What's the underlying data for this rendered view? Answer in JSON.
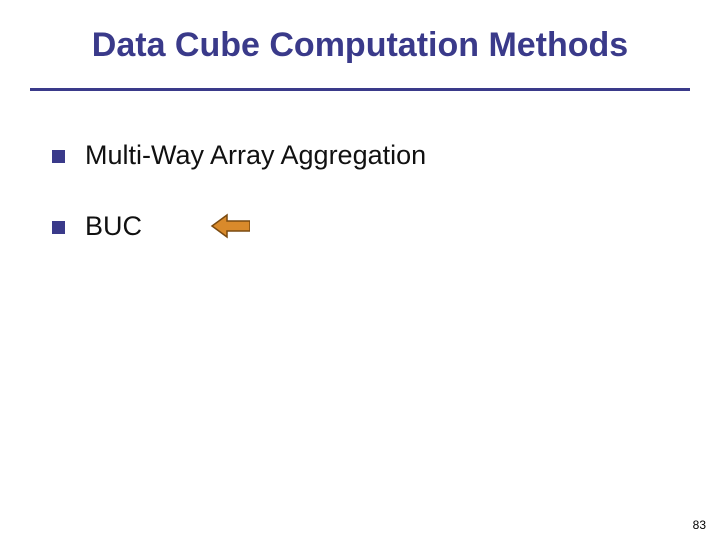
{
  "title": "Data Cube Computation Methods",
  "bullets": {
    "item0": "Multi-Way Array Aggregation",
    "item1": "BUC"
  },
  "page_number": "83"
}
